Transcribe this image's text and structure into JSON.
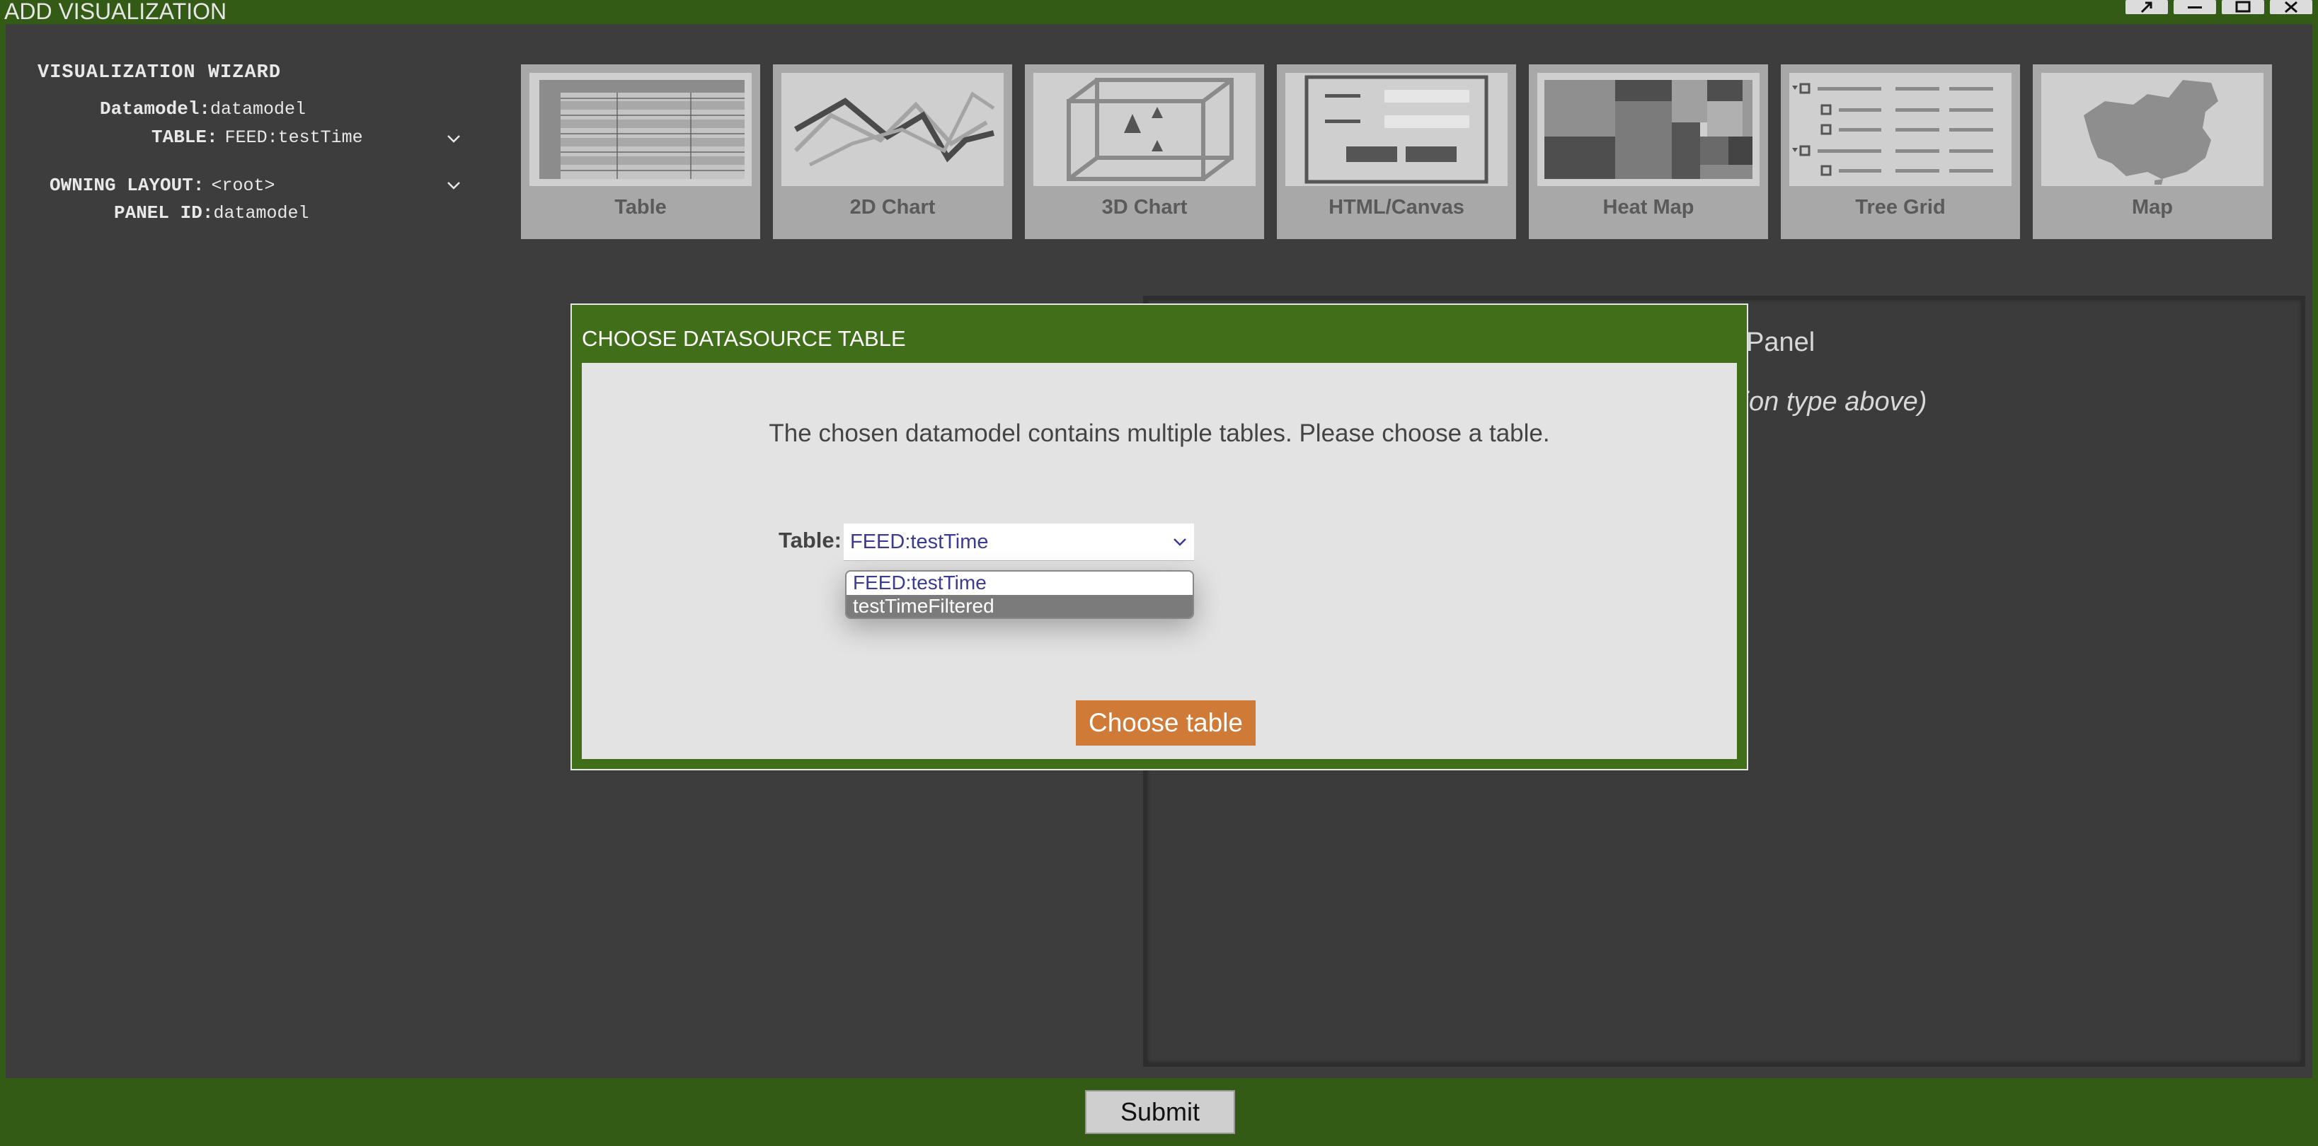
{
  "window": {
    "title": "ADD VISUALIZATION",
    "controls": [
      "pin-icon",
      "minimize-icon",
      "maximize-icon",
      "close-icon"
    ]
  },
  "wizard": {
    "heading": "VISUALIZATION WIZARD",
    "datamodel_label": "Datamodel:",
    "datamodel_value": "datamodel",
    "table_label": "TABLE:",
    "table_value": "FEED:testTime",
    "owning_layout_label": "OWNING LAYOUT:",
    "owning_layout_value": "<root>",
    "panel_id_label": "PANEL ID:",
    "panel_id_value": "datamodel"
  },
  "viz_types": [
    {
      "label": "Table",
      "icon": "table-icon"
    },
    {
      "label": "2D Chart",
      "icon": "line-chart-icon"
    },
    {
      "label": "3D Chart",
      "icon": "cube-chart-icon"
    },
    {
      "label": "HTML/Canvas",
      "icon": "html-canvas-icon"
    },
    {
      "label": "Heat Map",
      "icon": "heat-map-icon"
    },
    {
      "label": "Tree Grid",
      "icon": "tree-grid-icon"
    },
    {
      "label": "Map",
      "icon": "map-icon"
    }
  ],
  "preview": {
    "title_fragment": "Panel",
    "hint_fragment": "tion type above)"
  },
  "dialog": {
    "title": "CHOOSE DATASOURCE TABLE",
    "message": "The chosen datamodel contains multiple tables. Please choose a table.",
    "table_label": "Table:",
    "selected": "FEED:testTime",
    "options": [
      "FEED:testTime",
      "testTimeFiltered"
    ],
    "highlighted_option": "testTimeFiltered",
    "choose_button": "Choose table"
  },
  "footer": {
    "submit_label": "Submit"
  },
  "colors": {
    "frame_green": "#345b15",
    "dialog_green": "#416f19",
    "background": "#3d3d3d",
    "choose_button": "#d07a38",
    "selected_text": "#3b3b8f"
  }
}
